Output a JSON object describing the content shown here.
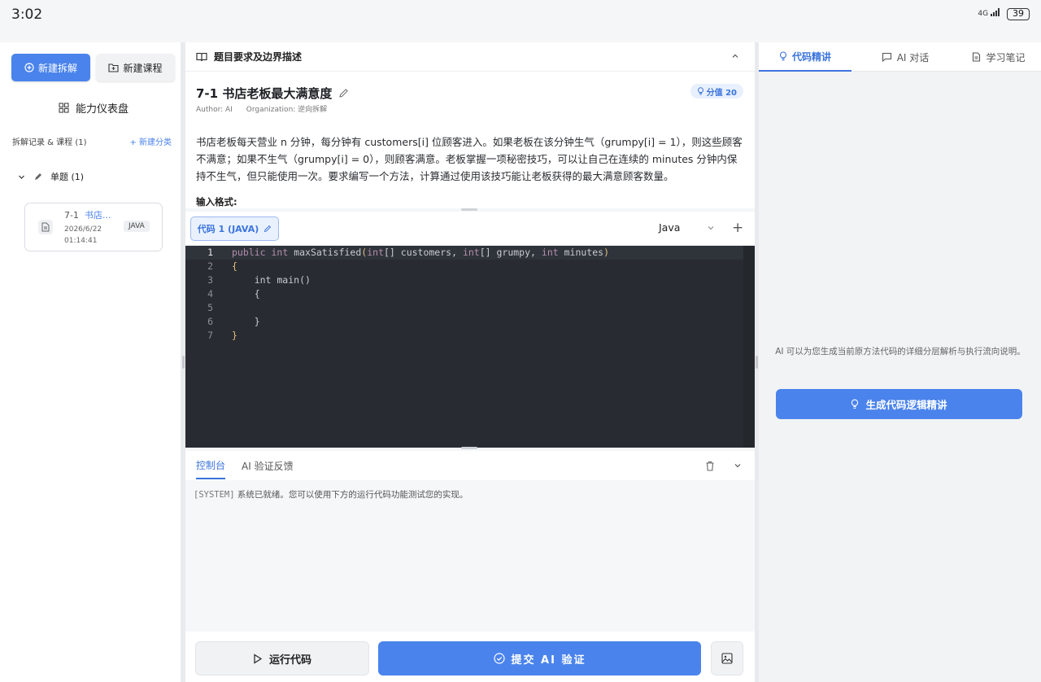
{
  "status_bar": {
    "time": "3:02",
    "signal": "4G",
    "battery": "39"
  },
  "sidebar": {
    "new_decompose": "新建拆解",
    "new_course": "新建课程",
    "dashboard": "能力仪表盘",
    "section_title": "拆解记录 & 课程 (1)",
    "new_category": "+ 新建分类",
    "group_label": "单题 (1)",
    "card": {
      "prefix": "7-1",
      "title": "书店...",
      "date": "2026/6/22",
      "time": "01:14:41",
      "lang_badge": "JAVA"
    }
  },
  "problem": {
    "header": "题目要求及边界描述",
    "title": "7-1 书店老板最大满意度",
    "author": "Author: AI",
    "organization": "Organization: 逆向拆解",
    "score": "分值 20",
    "description": "书店老板每天营业 n 分钟，每分钟有 customers[i] 位顾客进入。如果老板在该分钟生气（grumpy[i] = 1），则这些顾客不满意；如果不生气（grumpy[i] = 0），则顾客满意。老板掌握一项秘密技巧，可以让自己在连续的 minutes 分钟内保持不生气，但只能使用一次。要求编写一个方法，计算通过使用该技巧能让老板获得的最大满意顾客数量。",
    "input_format": "输入格式:"
  },
  "editor": {
    "tab_label": "代码 1 (JAVA)",
    "language": "Java",
    "line_numbers": [
      "1",
      "2",
      "3",
      "4",
      "5",
      "6",
      "7"
    ]
  },
  "console": {
    "tabs": [
      "控制台",
      "AI 验证反馈"
    ],
    "system_tag": "[SYSTEM]",
    "message": "系统已就绪。您可以使用下方的运行代码功能测试您的实现。"
  },
  "actions": {
    "run": "运行代码",
    "submit": "提交 AI 验证"
  },
  "right_panel": {
    "tabs": [
      "代码精讲",
      "AI 对话",
      "学习笔记"
    ],
    "message": "AI 可以为您生成当前原方法代码的详细分层解析与执行流向说明。",
    "generate": "生成代码逻辑精讲"
  },
  "colors": {
    "accent": "#4a83ec",
    "editor_bg": "#282b31"
  }
}
